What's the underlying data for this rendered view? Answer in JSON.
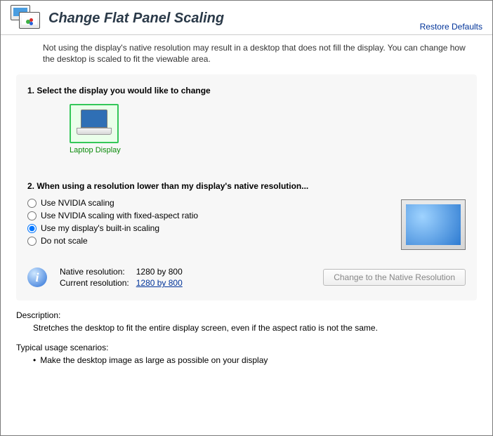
{
  "header": {
    "title": "Change Flat Panel Scaling",
    "restore": "Restore Defaults"
  },
  "intro": "Not using the display's native resolution may result in a desktop that does not fill the display. You can change how the desktop is scaled to fit the viewable area.",
  "step1": {
    "title": "1. Select the display you would like to change",
    "displays": [
      {
        "label": "Laptop Display"
      }
    ]
  },
  "step2": {
    "title": "2. When using a resolution lower than my display's native resolution...",
    "options": [
      "Use NVIDIA scaling",
      "Use NVIDIA scaling with fixed-aspect ratio",
      "Use my display's built-in scaling",
      "Do not scale"
    ],
    "selectedIndex": 2
  },
  "resolution": {
    "nativeLabel": "Native resolution:",
    "nativeValue": "1280 by 800",
    "currentLabel": "Current resolution:",
    "currentValue": "1280 by 800",
    "changeButton": "Change to the Native Resolution"
  },
  "description": {
    "title": "Description:",
    "body": "Stretches the desktop to fit the entire display screen, even if the aspect ratio is not the same."
  },
  "scenarios": {
    "title": "Typical usage scenarios:",
    "items": [
      "Make the desktop image as large as possible on your display"
    ]
  }
}
